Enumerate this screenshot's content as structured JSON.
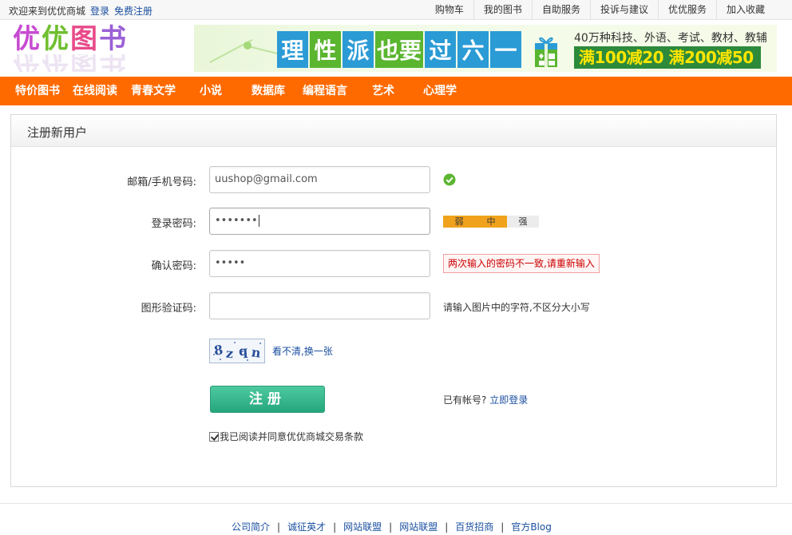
{
  "topbar": {
    "welcome": "欢迎来到优优商城",
    "login": "登录",
    "register": "免费注册",
    "links": [
      "购物车",
      "我的图书",
      "自助服务",
      "投诉与建议",
      "优优服务",
      "加入收藏"
    ]
  },
  "logo": {
    "chars": [
      "优",
      "优",
      "图",
      "书"
    ]
  },
  "banner": {
    "tiles": [
      {
        "text": "理",
        "color": "#2b9bd6"
      },
      {
        "text": "性",
        "color": "#5ab52f"
      },
      {
        "text": "派",
        "color": "#2b9bd6"
      },
      {
        "text": "也",
        "color": "#5ab52f"
      },
      {
        "text": "要",
        "color": "#5ab52f"
      },
      {
        "text": "过",
        "color": "#2b9bd6"
      },
      {
        "text": "六",
        "color": "#2b9bd6"
      },
      {
        "text": "一",
        "color": "#2b9bd6"
      }
    ],
    "promo_top": "40万种科技、外语、考试、教材、教辅",
    "promo_bottom": "满100减20  满200减50"
  },
  "nav": {
    "items": [
      "特价图书",
      "在线阅读",
      "青春文学",
      "小说",
      "数据库",
      "编程语言",
      "艺术",
      "心理学"
    ]
  },
  "form": {
    "title": "注册新用户",
    "email_label": "邮箱/手机号码:",
    "email_value": "uushop@gmail.com",
    "password_label": "登录密码:",
    "password_value": "•••••••",
    "strength": {
      "weak": "弱",
      "mid": "中",
      "strong": "强"
    },
    "confirm_label": "确认密码:",
    "confirm_value": "•••••",
    "confirm_error": "两次输入的密码不一致,请重新输入",
    "captcha_label": "图形验证码:",
    "captcha_value": "",
    "captcha_hint": "请输入图片中的字符,不区分大小写",
    "captcha_text": [
      "8",
      "z",
      "q",
      "n"
    ],
    "captcha_refresh": "看不清,换一张",
    "register_button": "注册",
    "has_account": "已有帐号?",
    "login_now": "立即登录",
    "agree_text": "我已阅读并同意优优商城交易条款",
    "agree_checked": true
  },
  "footer": {
    "links": [
      "公司简介",
      "诚征英才",
      "网站联盟",
      "网站联盟",
      "百货招商",
      "官方Blog"
    ]
  },
  "colors": {
    "nav_bg": "#ff6a00",
    "link": "#1a4fa0",
    "register_button": "#25a67c",
    "strength_fill": "#f0a21c",
    "error": "#cc0000"
  }
}
